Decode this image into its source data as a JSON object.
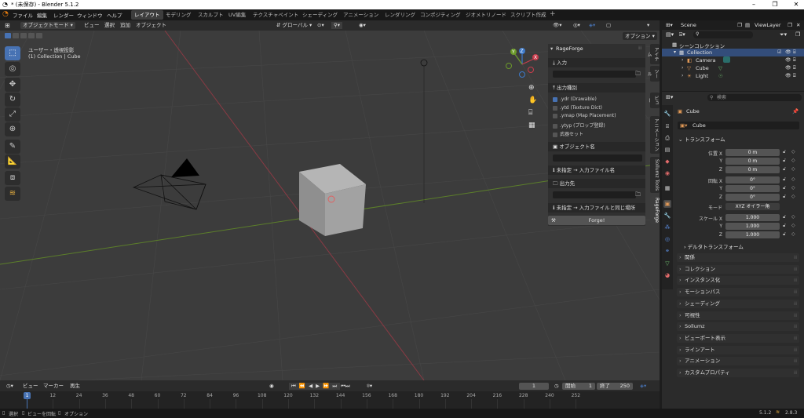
{
  "window": {
    "title": "* (未保存) - Blender 5.1.2"
  },
  "menus": [
    "ファイル",
    "編集",
    "レンダー",
    "ウィンドウ",
    "ヘルプ"
  ],
  "workspace_tabs": [
    "レイアウト",
    "モデリング",
    "スカルプト",
    "UV編集",
    "テクスチャペイント",
    "シェーディング",
    "アニメーション",
    "レンダリング",
    "コンポジティング",
    "ジオメトリノード",
    "スクリプト作成"
  ],
  "viewport_header": {
    "mode": "オブジェクトモード",
    "menus": [
      "ビュー",
      "選択",
      "追加",
      "オブジェクト"
    ],
    "orientation": "グローバル",
    "options": "オプション"
  },
  "viewport": {
    "view_label": "ユーザー・透視投影",
    "collection_label": "(1) Collection | Cube"
  },
  "npanel": {
    "title": "RageForge",
    "input_label": "入力",
    "output_type_label": "出力種別",
    "types": [
      {
        "label": ".ydr (Drawable)",
        "checked": true
      },
      {
        "label": ".ytd (Texture Dict)",
        "checked": false
      },
      {
        "label": ".ymap (Map Placement)",
        "checked": false
      },
      {
        "label": ".ytyp (プロップ登録)",
        "checked": false
      },
      {
        "label": "武器セット",
        "checked": false
      }
    ],
    "object_name_label": "オブジェクト名",
    "info1": "未指定 → 入力ファイル名",
    "output_dir_label": "出力先",
    "info2": "未指定 → 入力ファイルと同じ場所",
    "forge_button": "Forge!"
  },
  "side_tabs": [
    "アイテム",
    "ツール",
    "ビュー",
    "アニメーション",
    "Sollumz Tools",
    "RageForge"
  ],
  "timeline": {
    "menus": [
      "ビュー",
      "マーカー",
      "再生"
    ],
    "current_frame": "1",
    "start_label": "開始",
    "start": "1",
    "end_label": "終了",
    "end": "250",
    "ticks": [
      "1",
      "12",
      "24",
      "36",
      "48",
      "60",
      "72",
      "84",
      "96",
      "108",
      "120",
      "132",
      "144",
      "156",
      "168",
      "180",
      "192",
      "204",
      "216",
      "228",
      "240",
      "252"
    ]
  },
  "statusbar": {
    "select": "選択",
    "rotate": "ビューを回転",
    "options": "オプション",
    "version": "5.1.2",
    "addon_version": "2.8.3"
  },
  "outliner": {
    "scene": "Scene",
    "viewlayer": "ViewLayer",
    "search_placeholder": "",
    "root": "シーンコレクション",
    "collection": "Collection",
    "items": [
      "Camera",
      "Cube",
      "Light"
    ]
  },
  "properties": {
    "search_placeholder": "検索",
    "object_name": "Cube",
    "object_field": "Cube",
    "transform_label": "トランスフォーム",
    "location_label": "位置 X",
    "y": "Y",
    "z": "Z",
    "location": [
      "0 m",
      "0 m",
      "0 m"
    ],
    "rotation_label": "回転 X",
    "rotation": [
      "0°",
      "0°",
      "0°"
    ],
    "mode_label": "モード",
    "mode": "XYZ オイラー角",
    "scale_label": "スケール X",
    "scale": [
      "1.000",
      "1.000",
      "1.000"
    ],
    "delta_label": "デルタトランスフォーム",
    "sections": [
      "関係",
      "コレクション",
      "インスタンス化",
      "モーションパス",
      "シェーディング",
      "可視性",
      "Sollumz",
      "ビューポート表示",
      "ラインアート",
      "アニメーション",
      "カスタムプロパティ"
    ]
  },
  "colors": {
    "accent": "#4772b3",
    "x_axis": "#c83c4c",
    "y_axis": "#6c9a2a",
    "z_axis": "#3d7acb"
  }
}
